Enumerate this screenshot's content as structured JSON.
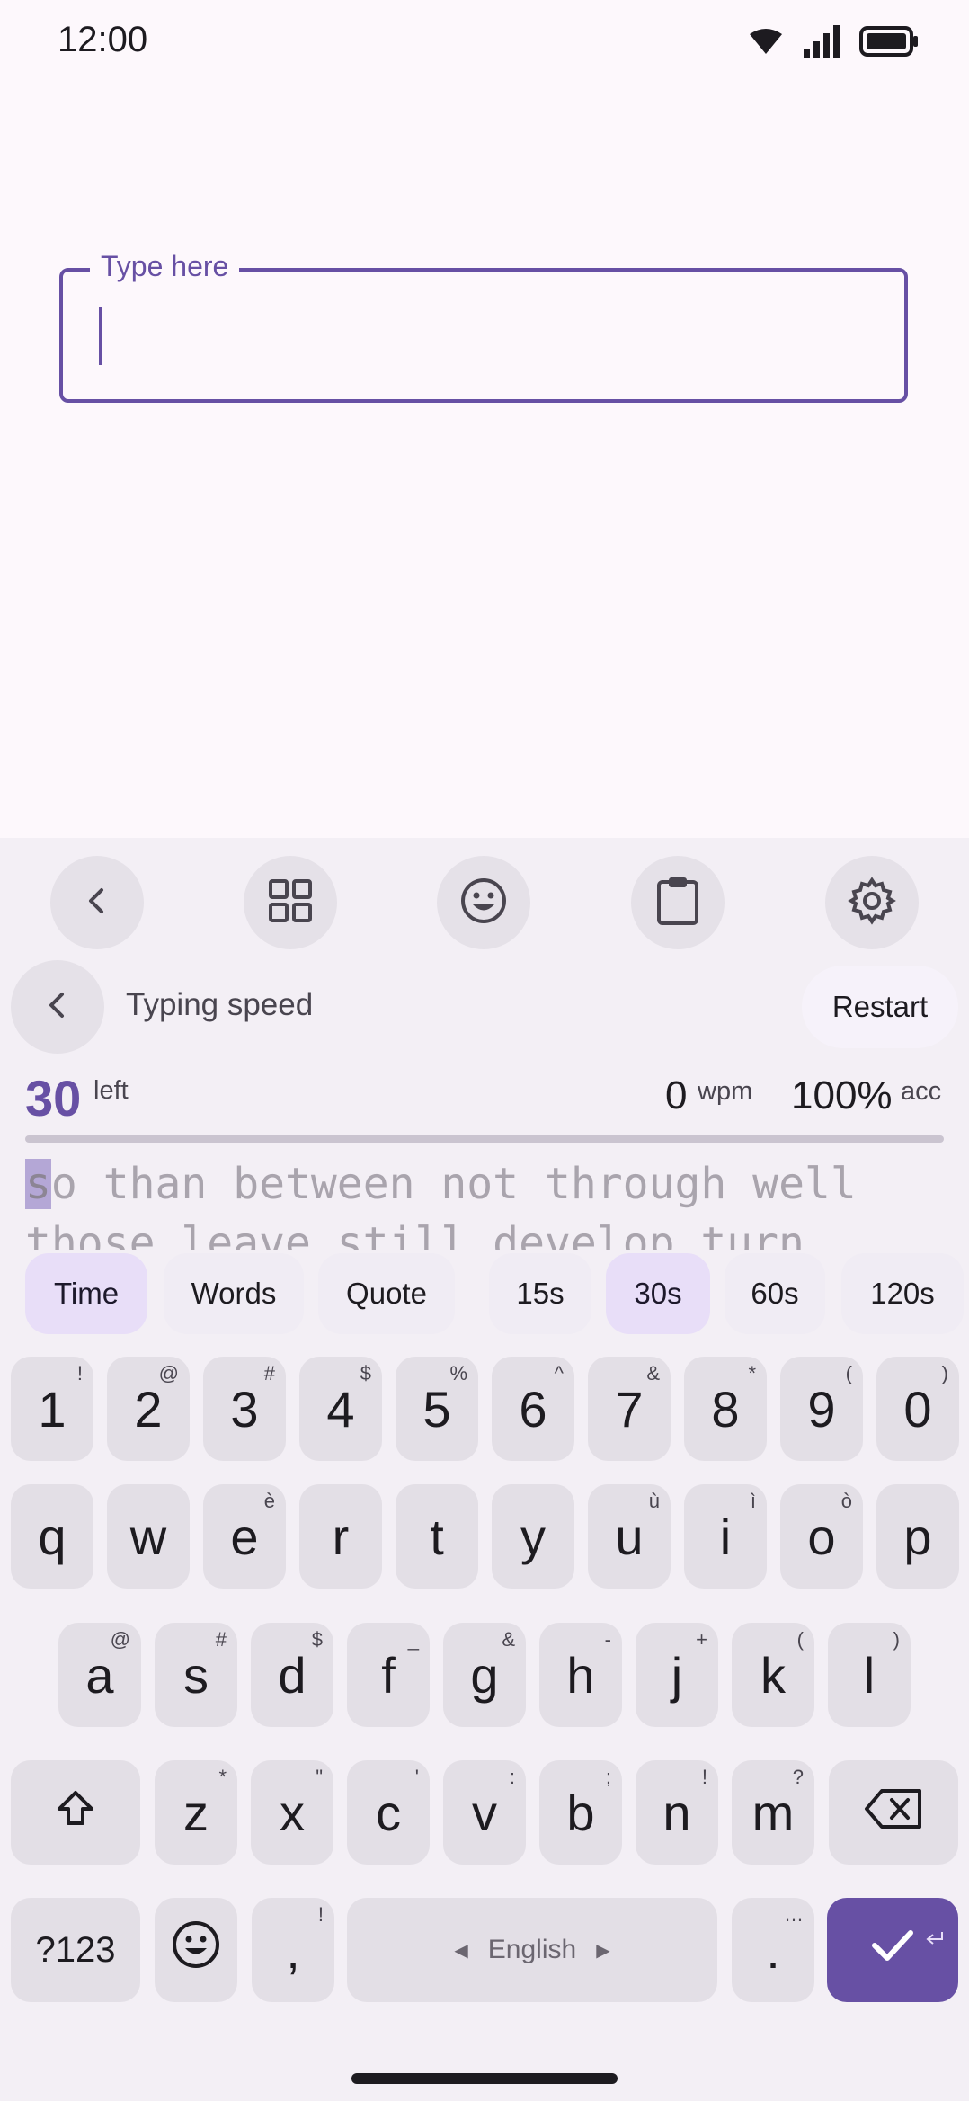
{
  "status_bar": {
    "time": "12:00",
    "icons": [
      "wifi-icon",
      "signal-icon",
      "battery-icon"
    ]
  },
  "text_field": {
    "label": "Type here",
    "value": ""
  },
  "toolbar": {
    "icons": [
      "chevron-left-icon",
      "grid-icon",
      "emoji-icon",
      "clipboard-icon",
      "gear-icon"
    ]
  },
  "panel": {
    "title": "Typing speed",
    "restart_label": "Restart",
    "time_left": "30",
    "time_left_unit": "left",
    "wpm": "0",
    "wpm_unit": "wpm",
    "accuracy": "100%",
    "accuracy_unit": "acc",
    "text_current_char": "s",
    "text_line1_rest": "o than between not through well",
    "text_line2": "those leave still develop turn"
  },
  "modes": [
    "Time",
    "Words",
    "Quote"
  ],
  "durations": [
    "15s",
    "30s",
    "60s",
    "120s"
  ],
  "selected_mode": "Time",
  "selected_duration": "30s",
  "keyboard": {
    "row_numbers": [
      {
        "k": "1",
        "h": "!"
      },
      {
        "k": "2",
        "h": "@"
      },
      {
        "k": "3",
        "h": "#"
      },
      {
        "k": "4",
        "h": "$"
      },
      {
        "k": "5",
        "h": "%"
      },
      {
        "k": "6",
        "h": "^"
      },
      {
        "k": "7",
        "h": "&"
      },
      {
        "k": "8",
        "h": "*"
      },
      {
        "k": "9",
        "h": "("
      },
      {
        "k": "0",
        "h": ")"
      }
    ],
    "row_q": [
      {
        "k": "q",
        "h": ""
      },
      {
        "k": "w",
        "h": ""
      },
      {
        "k": "e",
        "h": "è"
      },
      {
        "k": "r",
        "h": ""
      },
      {
        "k": "t",
        "h": ""
      },
      {
        "k": "y",
        "h": ""
      },
      {
        "k": "u",
        "h": "ù"
      },
      {
        "k": "i",
        "h": "ì"
      },
      {
        "k": "o",
        "h": "ò"
      },
      {
        "k": "p",
        "h": ""
      }
    ],
    "row_a": [
      {
        "k": "a",
        "h": "@"
      },
      {
        "k": "s",
        "h": "#"
      },
      {
        "k": "d",
        "h": "$"
      },
      {
        "k": "f",
        "h": "_"
      },
      {
        "k": "g",
        "h": "&"
      },
      {
        "k": "h",
        "h": "-"
      },
      {
        "k": "j",
        "h": "+"
      },
      {
        "k": "k",
        "h": "("
      },
      {
        "k": "l",
        "h": ")"
      }
    ],
    "row_z": [
      {
        "k": "z",
        "h": "*"
      },
      {
        "k": "x",
        "h": "\""
      },
      {
        "k": "c",
        "h": "'"
      },
      {
        "k": "v",
        "h": ":"
      },
      {
        "k": "b",
        "h": ";"
      },
      {
        "k": "n",
        "h": "!"
      },
      {
        "k": "m",
        "h": "?"
      }
    ],
    "symbols_label": "?123",
    "comma": {
      "k": ",",
      "h": "!"
    },
    "space_label": "English",
    "period": {
      "k": ".",
      "h": "…"
    }
  },
  "colors": {
    "accent": "#6750A4",
    "surface": "#FDF8FC",
    "keyboard_bg": "#F3EFF5",
    "key": "#E3DFE6"
  }
}
